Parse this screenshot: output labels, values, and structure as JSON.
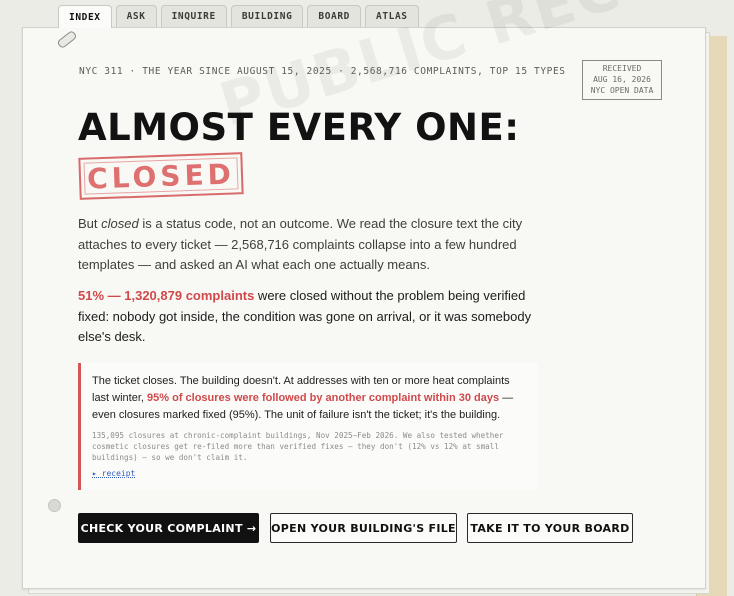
{
  "tabs": [
    {
      "label": "INDEX",
      "active": true
    },
    {
      "label": "ASK",
      "active": false
    },
    {
      "label": "INQUIRE",
      "active": false
    },
    {
      "label": "BUILDING",
      "active": false
    },
    {
      "label": "BOARD",
      "active": false
    },
    {
      "label": "ATLAS",
      "active": false
    }
  ],
  "watermark": "PUBLIC RECORD",
  "eyebrow": "NYC 311 · THE YEAR SINCE AUGUST 15, 2025 · 2,568,716 COMPLAINTS, TOP 15 TYPES",
  "received_stamp": {
    "line1": "RECEIVED",
    "line2": "AUG 16, 2026",
    "line3": "NYC OPEN DATA"
  },
  "headline": "ALMOST EVERY ONE:",
  "closed_stamp": "CLOSED",
  "lede": {
    "before": "But ",
    "emphasis": "closed",
    "after": " is a status code, not an outcome. We read the closure text the city attaches to every ticket — 2,568,716 complaints collapse into a few hundred templates — and asked an AI what each one actually means."
  },
  "finding": {
    "highlight": "51% — 1,320,879 complaints",
    "rest": " were closed without the problem being verified fixed: nobody got inside, the condition was gone on arrival, or it was somebody else's desk."
  },
  "callout": {
    "before": "The ticket closes. The building doesn't. At addresses with ten or more heat complaints last winter, ",
    "highlight": "95% of closures were followed by another complaint within 30 days",
    "after": " — even closures marked fixed (95%). The unit of failure isn't the ticket; it's the building.",
    "note": "135,095 closures at chronic-complaint buildings, Nov 2025–Feb 2026. We also tested whether cosmetic closures get re-filed more than verified fixes — they don't (12% vs 12% at small buildings) — so we don't claim it.",
    "receipt_link": "▸ receipt"
  },
  "buttons": {
    "check": "CHECK YOUR COMPLAINT →",
    "file": "OPEN YOUR BUILDING'S FILE",
    "board": "TAKE IT TO YOUR BOARD"
  },
  "colors": {
    "accent_red": "#d0494b",
    "stamp_red": "#de7070",
    "link_blue": "#2f5dbf",
    "folder_tan": "#e6d9b7"
  }
}
